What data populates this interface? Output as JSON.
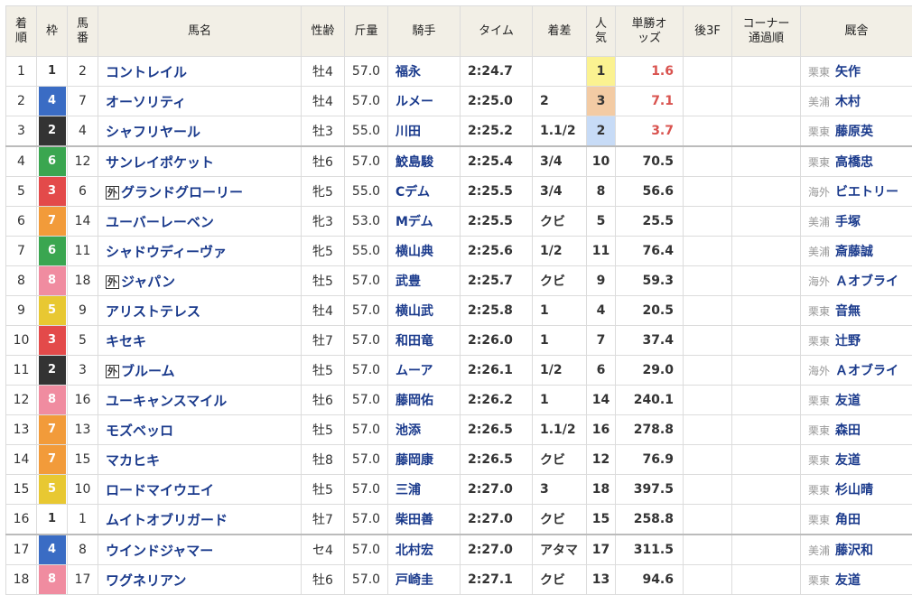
{
  "headers": {
    "rank": "着順",
    "waku": "枠",
    "umaban": "馬番",
    "horse": "馬名",
    "sexage": "性齢",
    "weight": "斤量",
    "jockey": "騎手",
    "time": "タイム",
    "margin": "着差",
    "popularity": "人気",
    "odds": "単勝オッズ",
    "last3f": "後3F",
    "corner": "コーナー通過順",
    "trainer": "厩舎"
  },
  "waku_colors": {
    "1": {
      "bg": "#ffffff",
      "fg": "#333333"
    },
    "2": {
      "bg": "#333333",
      "fg": "#ffffff"
    },
    "3": {
      "bg": "#e34a4a",
      "fg": "#ffffff"
    },
    "4": {
      "bg": "#3a6cc4",
      "fg": "#ffffff"
    },
    "5": {
      "bg": "#e8c832",
      "fg": "#ffffff"
    },
    "6": {
      "bg": "#3aa650",
      "fg": "#ffffff"
    },
    "7": {
      "bg": "#f29b3a",
      "fg": "#ffffff"
    },
    "8": {
      "bg": "#f08ca0",
      "fg": "#ffffff"
    }
  },
  "rows": [
    {
      "rank": "1",
      "waku": "1",
      "umaban": "2",
      "foreign": "",
      "horse": "コントレイル",
      "sexage": "牡4",
      "weight": "57.0",
      "jockey": "福永",
      "time": "2:24.7",
      "margin": "",
      "pop": "1",
      "odds": "1.6",
      "last3f": "",
      "corner": "",
      "region": "栗東",
      "trainer": "矢作"
    },
    {
      "rank": "2",
      "waku": "4",
      "umaban": "7",
      "foreign": "",
      "horse": "オーソリティ",
      "sexage": "牡4",
      "weight": "57.0",
      "jockey": "ルメー",
      "time": "2:25.0",
      "margin": "2",
      "pop": "3",
      "odds": "7.1",
      "last3f": "",
      "corner": "",
      "region": "美浦",
      "trainer": "木村"
    },
    {
      "rank": "3",
      "waku": "2",
      "umaban": "4",
      "foreign": "",
      "horse": "シャフリヤール",
      "sexage": "牡3",
      "weight": "55.0",
      "jockey": "川田",
      "time": "2:25.2",
      "margin": "1.1/2",
      "pop": "2",
      "odds": "3.7",
      "last3f": "",
      "corner": "",
      "region": "栗東",
      "trainer": "藤原英"
    },
    {
      "rank": "4",
      "waku": "6",
      "umaban": "12",
      "foreign": "",
      "horse": "サンレイポケット",
      "sexage": "牡6",
      "weight": "57.0",
      "jockey": "鮫島駿",
      "time": "2:25.4",
      "margin": "3/4",
      "pop": "10",
      "odds": "70.5",
      "last3f": "",
      "corner": "",
      "region": "栗東",
      "trainer": "高橋忠"
    },
    {
      "rank": "5",
      "waku": "3",
      "umaban": "6",
      "foreign": "外",
      "horse": "グランドグローリー",
      "sexage": "牝5",
      "weight": "55.0",
      "jockey": "Cデム",
      "time": "2:25.5",
      "margin": "3/4",
      "pop": "8",
      "odds": "56.6",
      "last3f": "",
      "corner": "",
      "region": "海外",
      "trainer": "ビエトリー"
    },
    {
      "rank": "6",
      "waku": "7",
      "umaban": "14",
      "foreign": "",
      "horse": "ユーバーレーベン",
      "sexage": "牝3",
      "weight": "53.0",
      "jockey": "Mデム",
      "time": "2:25.5",
      "margin": "クビ",
      "pop": "5",
      "odds": "25.5",
      "last3f": "",
      "corner": "",
      "region": "美浦",
      "trainer": "手塚"
    },
    {
      "rank": "7",
      "waku": "6",
      "umaban": "11",
      "foreign": "",
      "horse": "シャドウディーヴァ",
      "sexage": "牝5",
      "weight": "55.0",
      "jockey": "横山典",
      "time": "2:25.6",
      "margin": "1/2",
      "pop": "11",
      "odds": "76.4",
      "last3f": "",
      "corner": "",
      "region": "美浦",
      "trainer": "斎藤誠"
    },
    {
      "rank": "8",
      "waku": "8",
      "umaban": "18",
      "foreign": "外",
      "horse": "ジャパン",
      "sexage": "牡5",
      "weight": "57.0",
      "jockey": "武豊",
      "time": "2:25.7",
      "margin": "クビ",
      "pop": "9",
      "odds": "59.3",
      "last3f": "",
      "corner": "",
      "region": "海外",
      "trainer": "Ａオブライ"
    },
    {
      "rank": "9",
      "waku": "5",
      "umaban": "9",
      "foreign": "",
      "horse": "アリストテレス",
      "sexage": "牡4",
      "weight": "57.0",
      "jockey": "横山武",
      "time": "2:25.8",
      "margin": "1",
      "pop": "4",
      "odds": "20.5",
      "last3f": "",
      "corner": "",
      "region": "栗東",
      "trainer": "音無"
    },
    {
      "rank": "10",
      "waku": "3",
      "umaban": "5",
      "foreign": "",
      "horse": "キセキ",
      "sexage": "牡7",
      "weight": "57.0",
      "jockey": "和田竜",
      "time": "2:26.0",
      "margin": "1",
      "pop": "7",
      "odds": "37.4",
      "last3f": "",
      "corner": "",
      "region": "栗東",
      "trainer": "辻野"
    },
    {
      "rank": "11",
      "waku": "2",
      "umaban": "3",
      "foreign": "外",
      "horse": "ブルーム",
      "sexage": "牡5",
      "weight": "57.0",
      "jockey": "ムーア",
      "time": "2:26.1",
      "margin": "1/2",
      "pop": "6",
      "odds": "29.0",
      "last3f": "",
      "corner": "",
      "region": "海外",
      "trainer": "Ａオブライ"
    },
    {
      "rank": "12",
      "waku": "8",
      "umaban": "16",
      "foreign": "",
      "horse": "ユーキャンスマイル",
      "sexage": "牡6",
      "weight": "57.0",
      "jockey": "藤岡佑",
      "time": "2:26.2",
      "margin": "1",
      "pop": "14",
      "odds": "240.1",
      "last3f": "",
      "corner": "",
      "region": "栗東",
      "trainer": "友道"
    },
    {
      "rank": "13",
      "waku": "7",
      "umaban": "13",
      "foreign": "",
      "horse": "モズベッロ",
      "sexage": "牡5",
      "weight": "57.0",
      "jockey": "池添",
      "time": "2:26.5",
      "margin": "1.1/2",
      "pop": "16",
      "odds": "278.8",
      "last3f": "",
      "corner": "",
      "region": "栗東",
      "trainer": "森田"
    },
    {
      "rank": "14",
      "waku": "7",
      "umaban": "15",
      "foreign": "",
      "horse": "マカヒキ",
      "sexage": "牡8",
      "weight": "57.0",
      "jockey": "藤岡康",
      "time": "2:26.5",
      "margin": "クビ",
      "pop": "12",
      "odds": "76.9",
      "last3f": "",
      "corner": "",
      "region": "栗東",
      "trainer": "友道"
    },
    {
      "rank": "15",
      "waku": "5",
      "umaban": "10",
      "foreign": "",
      "horse": "ロードマイウエイ",
      "sexage": "牡5",
      "weight": "57.0",
      "jockey": "三浦",
      "time": "2:27.0",
      "margin": "3",
      "pop": "18",
      "odds": "397.5",
      "last3f": "",
      "corner": "",
      "region": "栗東",
      "trainer": "杉山晴"
    },
    {
      "rank": "16",
      "waku": "1",
      "umaban": "1",
      "foreign": "",
      "horse": "ムイトオブリガード",
      "sexage": "牡7",
      "weight": "57.0",
      "jockey": "柴田善",
      "time": "2:27.0",
      "margin": "クビ",
      "pop": "15",
      "odds": "258.8",
      "last3f": "",
      "corner": "",
      "region": "栗東",
      "trainer": "角田"
    },
    {
      "rank": "17",
      "waku": "4",
      "umaban": "8",
      "foreign": "",
      "horse": "ウインドジャマー",
      "sexage": "セ4",
      "weight": "57.0",
      "jockey": "北村宏",
      "time": "2:27.0",
      "margin": "アタマ",
      "pop": "17",
      "odds": "311.5",
      "last3f": "",
      "corner": "",
      "region": "美浦",
      "trainer": "藤沢和"
    },
    {
      "rank": "18",
      "waku": "8",
      "umaban": "17",
      "foreign": "",
      "horse": "ワグネリアン",
      "sexage": "牡6",
      "weight": "57.0",
      "jockey": "戸崎圭",
      "time": "2:27.1",
      "margin": "クビ",
      "pop": "13",
      "odds": "94.6",
      "last3f": "",
      "corner": "",
      "region": "栗東",
      "trainer": "友道"
    }
  ]
}
